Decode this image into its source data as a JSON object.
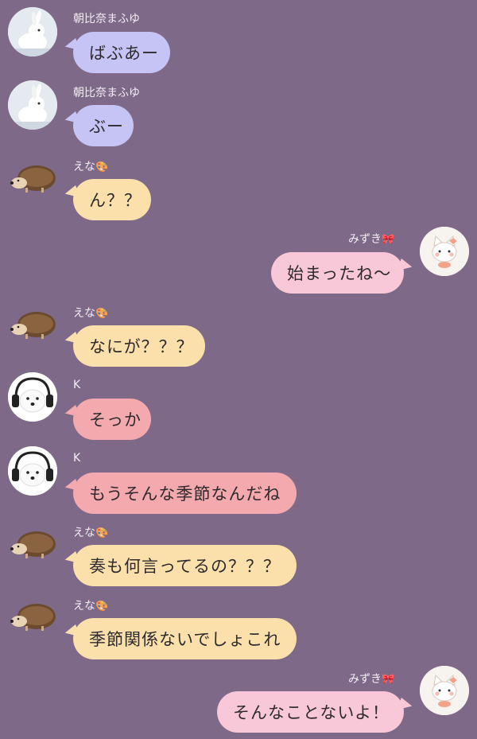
{
  "messages": [
    {
      "sender": "朝比奈まふゆ",
      "text": "ばぶあー",
      "side": "left"
    },
    {
      "sender": "朝比奈まふゆ",
      "text": "ぶー",
      "side": "left"
    },
    {
      "sender": "えな",
      "sender_emoji": "🎨",
      "text": "ん？？",
      "side": "left"
    },
    {
      "sender": "みずき",
      "sender_emoji": "🎀",
      "text": "始まったね〜",
      "side": "right"
    },
    {
      "sender": "えな",
      "sender_emoji": "🎨",
      "text": "なにが？？？",
      "side": "left"
    },
    {
      "sender": "K",
      "text": "そっか",
      "side": "left"
    },
    {
      "sender": "K",
      "text": "もうそんな季節なんだね",
      "side": "left"
    },
    {
      "sender": "えな",
      "sender_emoji": "🎨",
      "text": "奏も何言ってるの？？？",
      "side": "left"
    },
    {
      "sender": "えな",
      "sender_emoji": "🎨",
      "text": "季節関係ないでしょこれ",
      "side": "left"
    },
    {
      "sender": "みずき",
      "sender_emoji": "🎀",
      "text": "そんなことないよ！",
      "side": "right"
    }
  ],
  "colors": {
    "background": "#7e6a88",
    "mafuyu_bubble": "#c6c3f5",
    "ena_bubble": "#fbe0ab",
    "k_bubble": "#f3a9ad",
    "mizuki_bubble": "#f8c8d8"
  },
  "avatars": {
    "mafuyu": "white-rabbit-icon",
    "ena": "hedgehog-icon",
    "k": "white-dog-headphones-icon",
    "mizuki": "white-cat-bow-icon"
  }
}
